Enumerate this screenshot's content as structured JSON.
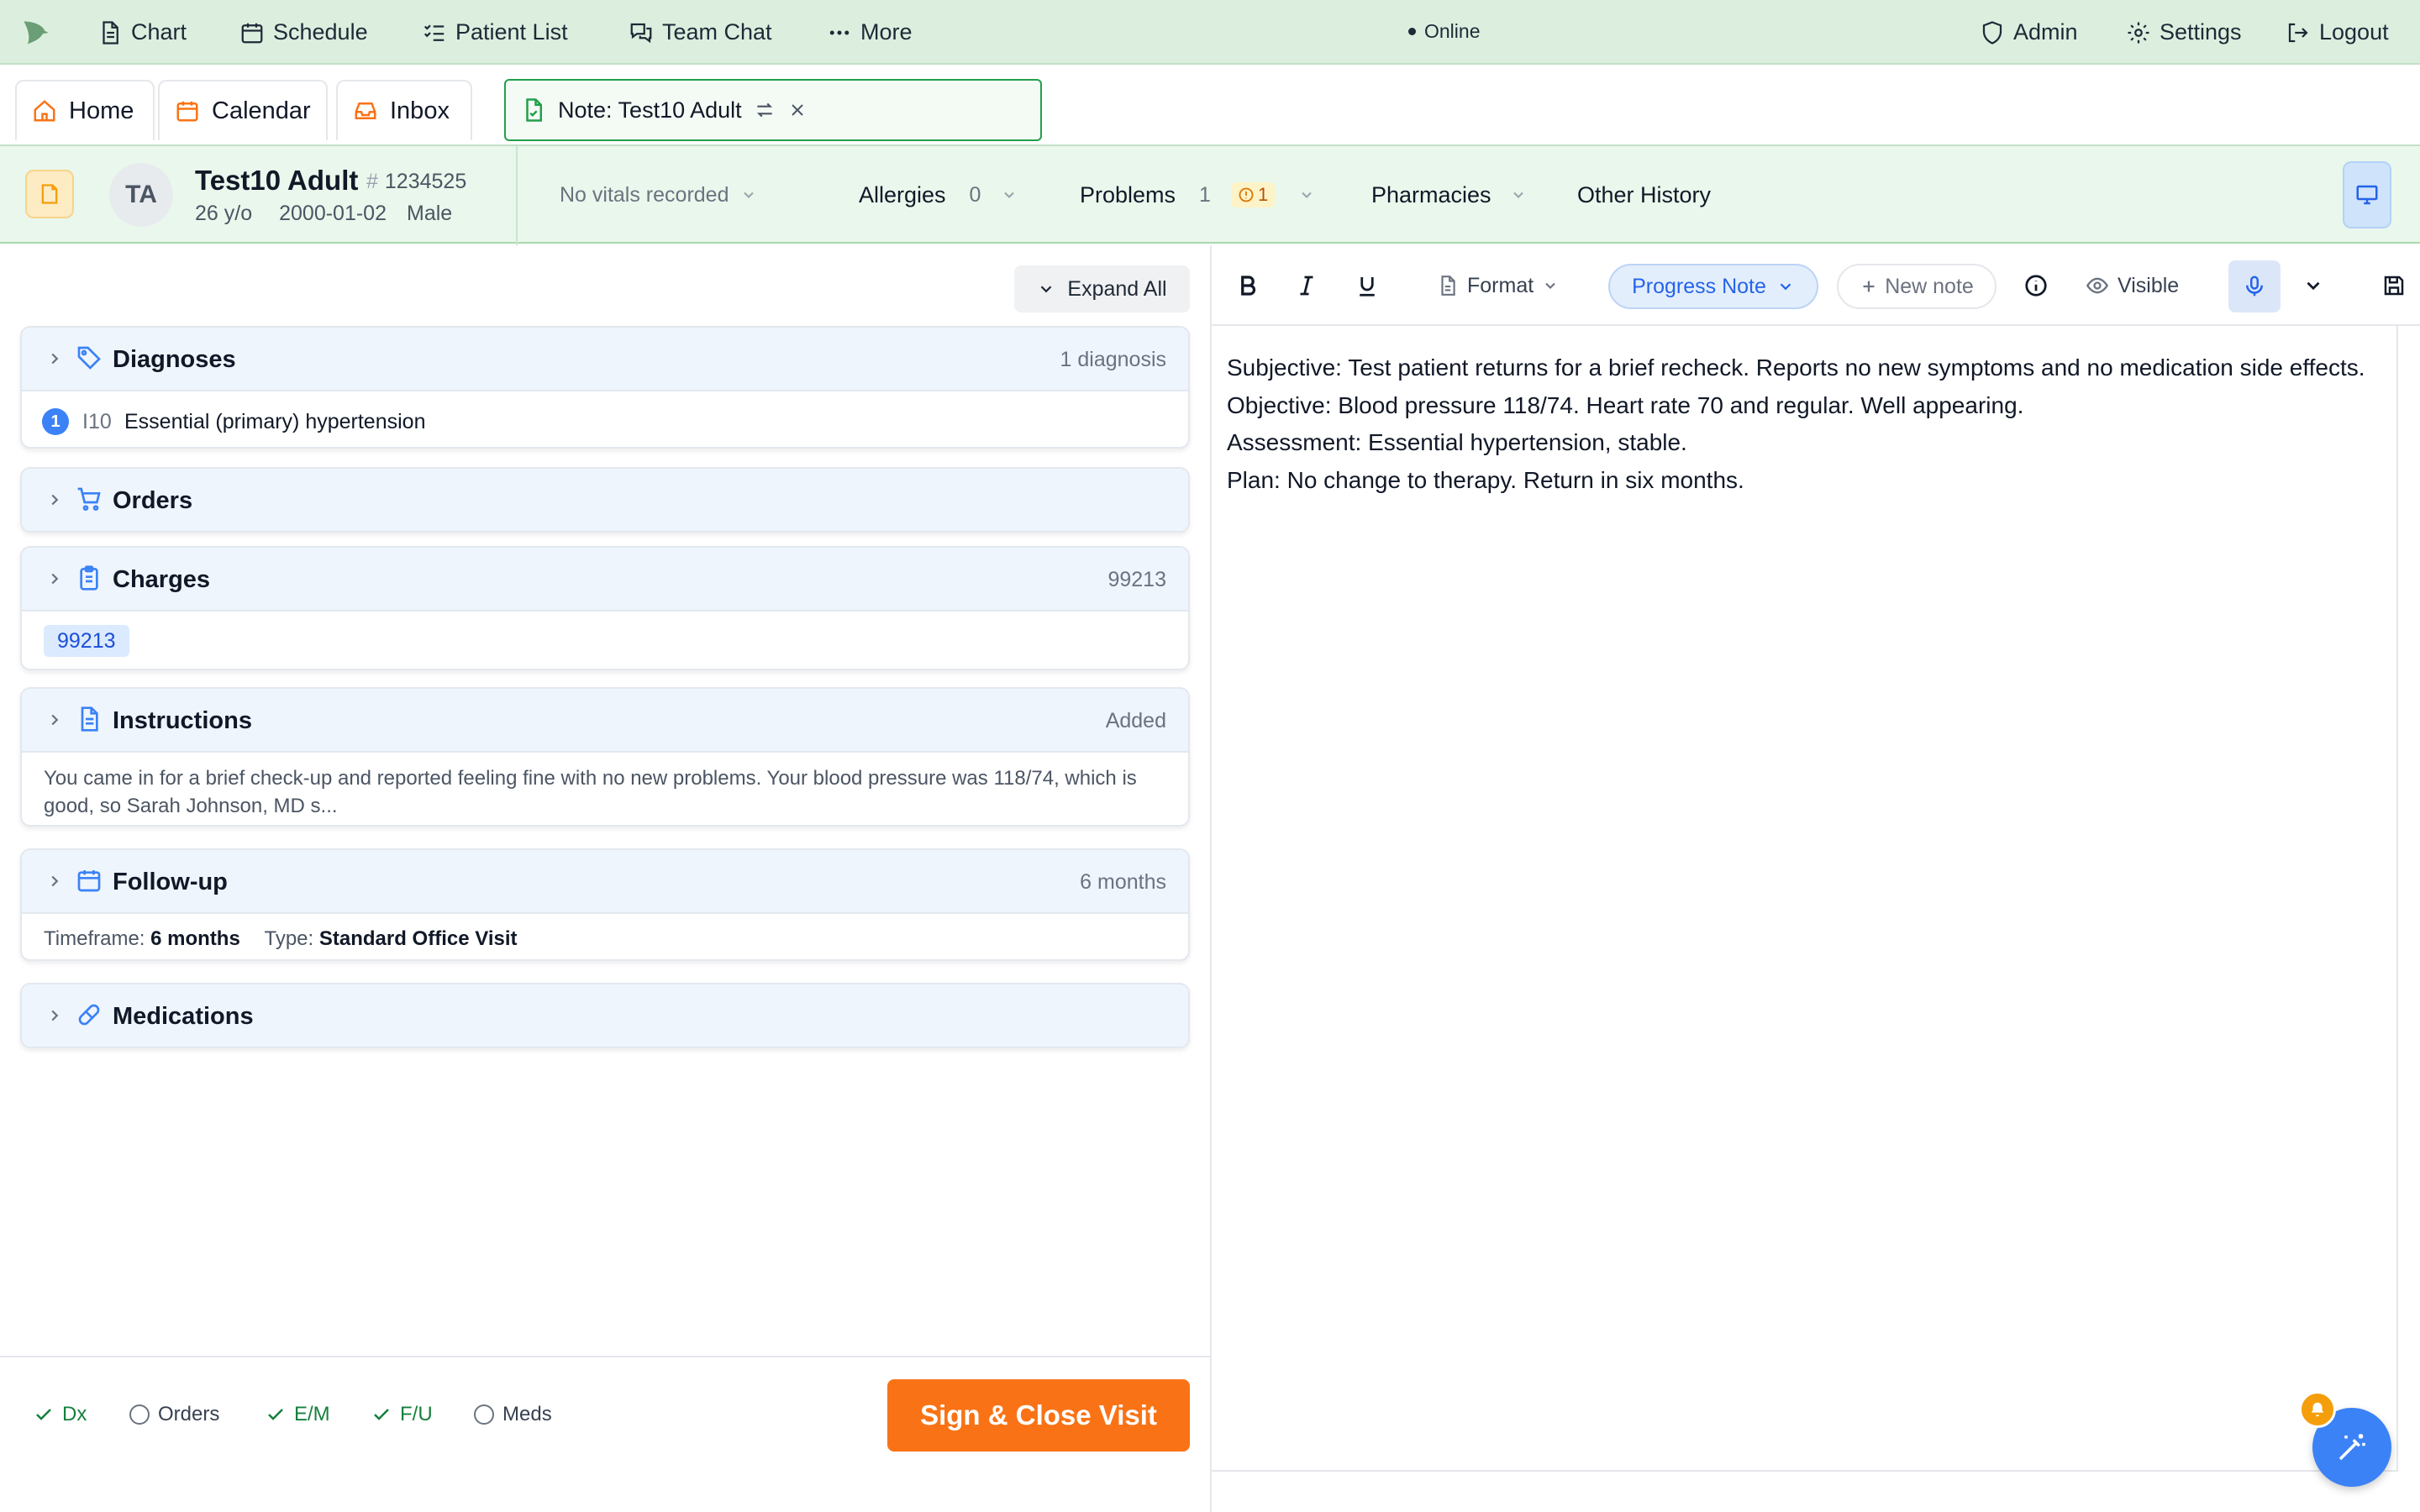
{
  "topnav": {
    "items": [
      {
        "label": "Chart",
        "icon": "file-text-icon"
      },
      {
        "label": "Schedule",
        "icon": "calendar-icon"
      },
      {
        "label": "Patient List",
        "icon": "list-check-icon"
      },
      {
        "label": "Team Chat",
        "icon": "chat-icon"
      },
      {
        "label": "More",
        "icon": "ellipsis-icon"
      }
    ],
    "status": "Online",
    "right_items": [
      {
        "label": "Admin",
        "icon": "shield-icon"
      },
      {
        "label": "Settings",
        "icon": "gear-icon"
      },
      {
        "label": "Logout",
        "icon": "logout-icon"
      }
    ]
  },
  "tabs": {
    "home": "Home",
    "calendar": "Calendar",
    "inbox": "Inbox",
    "note": "Note: Test10 Adult"
  },
  "patient": {
    "initials": "TA",
    "name": "Test10 Adult",
    "mrn": "1234525",
    "age": "26 y/o",
    "dob": "2000-01-02",
    "sex": "Male",
    "vitals": "No vitals recorded",
    "allergies_label": "Allergies",
    "allergies_count": "0",
    "problems_label": "Problems",
    "problems_count": "1",
    "problems_warning": "1",
    "pharmacies_label": "Pharmacies",
    "other_history_label": "Other History"
  },
  "left": {
    "expand_all": "Expand All",
    "diagnoses": {
      "title": "Diagnoses",
      "summary": "1 diagnosis",
      "items": [
        {
          "num": "1",
          "code": "I10",
          "desc": "Essential (primary) hypertension"
        }
      ]
    },
    "orders": {
      "title": "Orders"
    },
    "charges": {
      "title": "Charges",
      "summary": "99213",
      "chip": "99213"
    },
    "instructions": {
      "title": "Instructions",
      "summary": "Added",
      "text": "You came in for a brief check-up and reported feeling fine with no new problems. Your blood pressure was 118/74, which is good, so Sarah Johnson, MD s..."
    },
    "followup": {
      "title": "Follow-up",
      "summary": "6 months",
      "timeframe_label": "Timeframe:",
      "timeframe": "6 months",
      "type_label": "Type:",
      "type": "Standard Office Visit"
    },
    "medications": {
      "title": "Medications"
    }
  },
  "checklist": {
    "items": [
      {
        "label": "Dx",
        "done": true
      },
      {
        "label": "Orders",
        "done": false
      },
      {
        "label": "E/M",
        "done": true
      },
      {
        "label": "F/U",
        "done": true
      },
      {
        "label": "Meds",
        "done": false
      }
    ],
    "sign_button": "Sign & Close Visit"
  },
  "editor": {
    "format_label": "Format",
    "note_type": "Progress Note",
    "new_note": "New note",
    "visibility": "Visible",
    "lines": [
      "Subjective: Test patient returns for a brief recheck. Reports no new symptoms and no medication side effects.",
      "Objective: Blood pressure 118/74. Heart rate 70 and regular. Well appearing.",
      "Assessment: Essential hypertension, stable.",
      "Plan: No change to therapy. Return in six months."
    ]
  },
  "colors": {
    "topnav_bg": "#dcefdf",
    "accent_green": "#22a04b",
    "accent_blue": "#3b82f6",
    "sign_orange": "#f97316",
    "header_bg": "#eaf7ec"
  }
}
